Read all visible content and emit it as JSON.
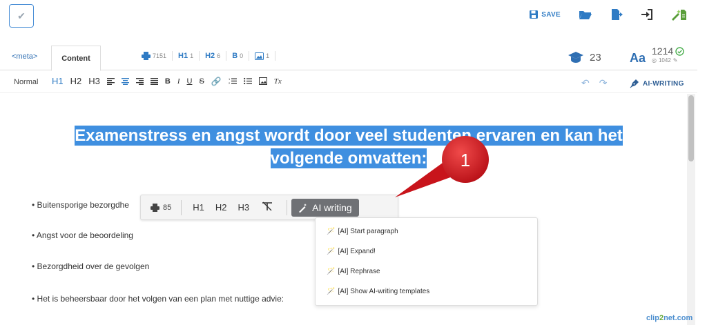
{
  "toolbar": {
    "save_label": "SAVE"
  },
  "tabs": {
    "meta_label": "<meta>",
    "content_label": "Content"
  },
  "stats": {
    "words": "7151",
    "h1_label": "H1",
    "h1_count": "1",
    "h2_label": "H2",
    "h2_count": "6",
    "bold_label": "B",
    "bold_count": "0",
    "images_count": "1"
  },
  "grade": {
    "value": "23"
  },
  "counter": {
    "aa_label": "Aa",
    "main": "1214",
    "sub": "1042"
  },
  "format_bar": {
    "normal_label": "Normal",
    "h1": "H1",
    "h2": "H2",
    "h3": "H3",
    "bold": "B",
    "italic": "I",
    "underline": "U",
    "strike": "S",
    "clear": "Tx",
    "ai_label": "AI-WRITING"
  },
  "editor": {
    "heading_line1": "Examenstress en angst wordt door veel studenten ervaren en kan het",
    "heading_line2": "volgende omvatten:",
    "bullets": [
      "• Buitensporige bezorgdhe",
      "• Angst voor de beoordeling",
      "• Bezorgdheid over de gevolgen",
      "• Het is beheersbaar door het volgen van een plan met nuttige advie:"
    ]
  },
  "bubble": {
    "count": "85",
    "h1": "H1",
    "h2": "H2",
    "h3": "H3",
    "ai_label": "AI writing"
  },
  "dropdown": {
    "items": [
      "[AI] Start paragraph",
      "[AI] Expand!",
      "[AI] Rephrase",
      "[AI] Show AI-writing templates"
    ]
  },
  "callout": {
    "number": "1"
  },
  "watermark": {
    "part1": "clip",
    "part2": "2",
    "part3": "net.com"
  },
  "colors": {
    "accent": "#2f7bc4",
    "selection": "#3f8fe0",
    "callout_red": "#c8141b"
  }
}
